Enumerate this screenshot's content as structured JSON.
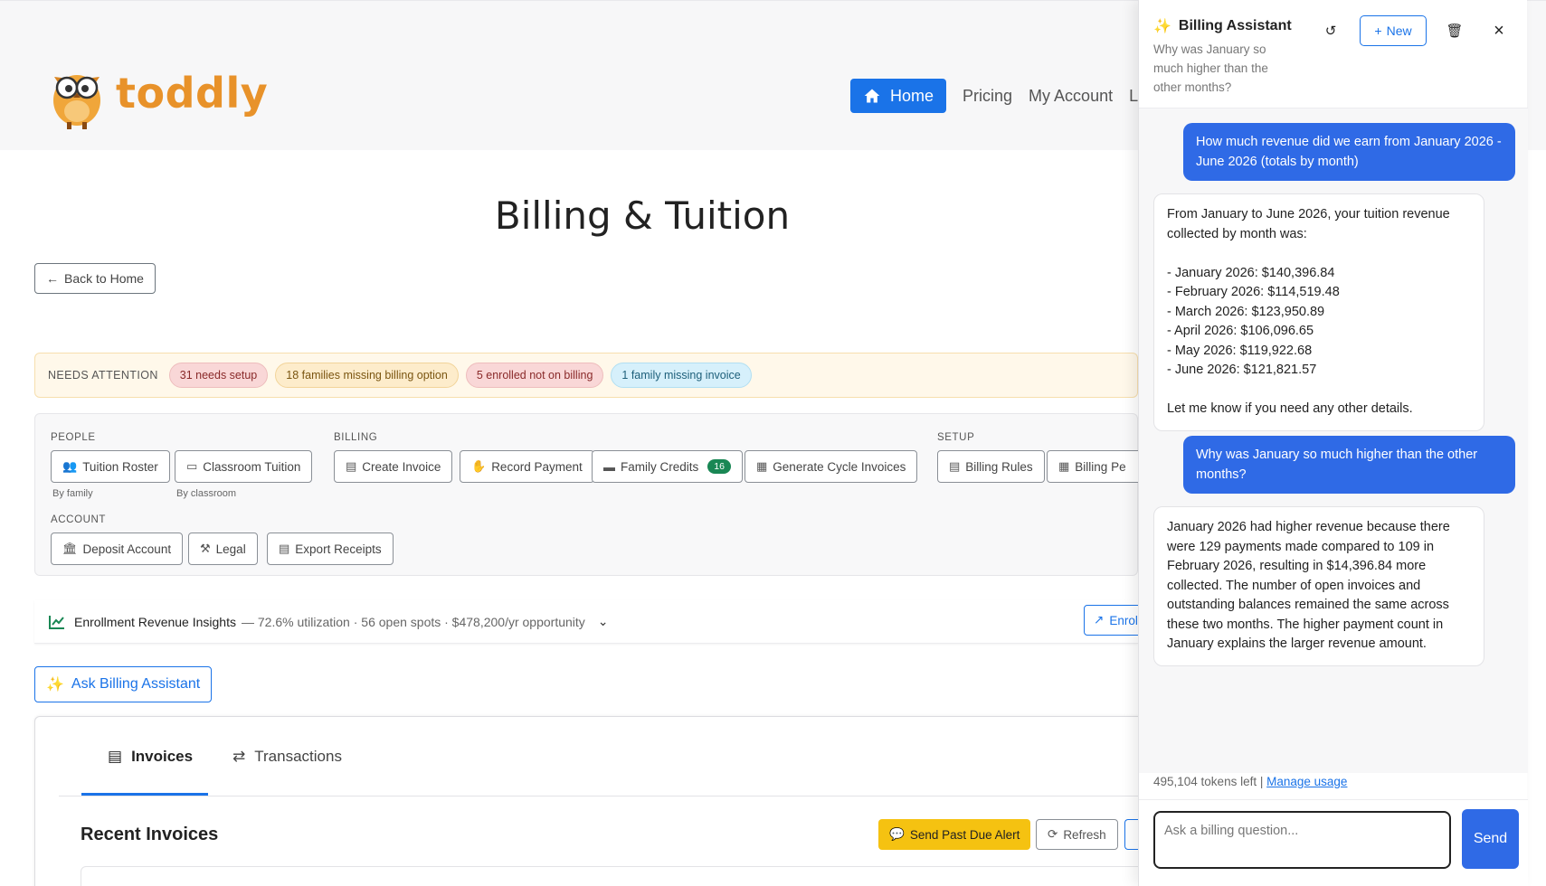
{
  "header": {
    "brand": "toddly",
    "nav": {
      "home": "Home",
      "pricing": "Pricing",
      "my_account": "My Account",
      "cutoff": "L"
    }
  },
  "page": {
    "title": "Billing & Tuition",
    "back_label": "Back to Home"
  },
  "attention": {
    "label": "NEEDS ATTENTION",
    "pills": [
      "31 needs setup",
      "18 families missing billing option",
      "5 enrolled not on billing",
      "1 family missing invoice"
    ]
  },
  "actions": {
    "people": {
      "label": "PEOPLE",
      "tuition_roster": "Tuition Roster",
      "tuition_roster_sub": "By family",
      "classroom_tuition": "Classroom Tuition",
      "classroom_tuition_sub": "By classroom"
    },
    "billing": {
      "label": "BILLING",
      "create_invoice": "Create Invoice",
      "record_payment": "Record Payment",
      "family_credits": "Family Credits",
      "family_credits_count": "16",
      "generate_cycle": "Generate Cycle Invoices"
    },
    "setup": {
      "label": "SETUP",
      "billing_rules": "Billing Rules",
      "billing_periods": "Billing Pe"
    },
    "account": {
      "label": "ACCOUNT",
      "deposit_account": "Deposit Account",
      "legal": "Legal",
      "export_receipts": "Export Receipts"
    }
  },
  "insights": {
    "title": "Enrollment Revenue Insights",
    "meta": "— 72.6% utilization · 56 open spots · $478,200/yr opportunity",
    "enroll_btn": "Enrol"
  },
  "ask_button": "Ask Billing Assistant",
  "invoices": {
    "tabs": [
      "Invoices",
      "Transactions"
    ],
    "section_title": "Recent Invoices",
    "past_due": "Send Past Due Alert",
    "refresh": "Refresh"
  },
  "assistant": {
    "title": "Billing Assistant",
    "subtitle": "Why was January so much higher than the other months?",
    "new_label": "New",
    "messages": [
      {
        "role": "user",
        "text": "How much revenue did we earn from January 2026 - June 2026 (totals by month)"
      },
      {
        "role": "assistant",
        "text": "From January to June 2026, your tuition revenue collected by month was:\n\n- January 2026: $140,396.84\n- February 2026: $114,519.48\n- March 2026: $123,950.89\n- April 2026: $106,096.65\n- May 2026: $119,922.68\n- June 2026: $121,821.57\n\nLet me know if you need any other details."
      },
      {
        "role": "user",
        "text": "Why was January so much higher than the other months?"
      },
      {
        "role": "assistant",
        "text": "January 2026 had higher revenue because there were 129 payments made compared to 109 in February 2026, resulting in $14,396.84 more collected. The number of open invoices and outstanding balances remained the same across these two months. The higher payment count in January explains the larger revenue amount."
      }
    ],
    "usage_text": "495,104 tokens left |",
    "manage_usage": "Manage usage",
    "input_placeholder": "Ask a billing question...",
    "send_label": "Send"
  },
  "colors": {
    "primary": "#1a73e8",
    "brand_orange": "#e8922a",
    "warning": "#f5c211",
    "success": "#198754"
  }
}
